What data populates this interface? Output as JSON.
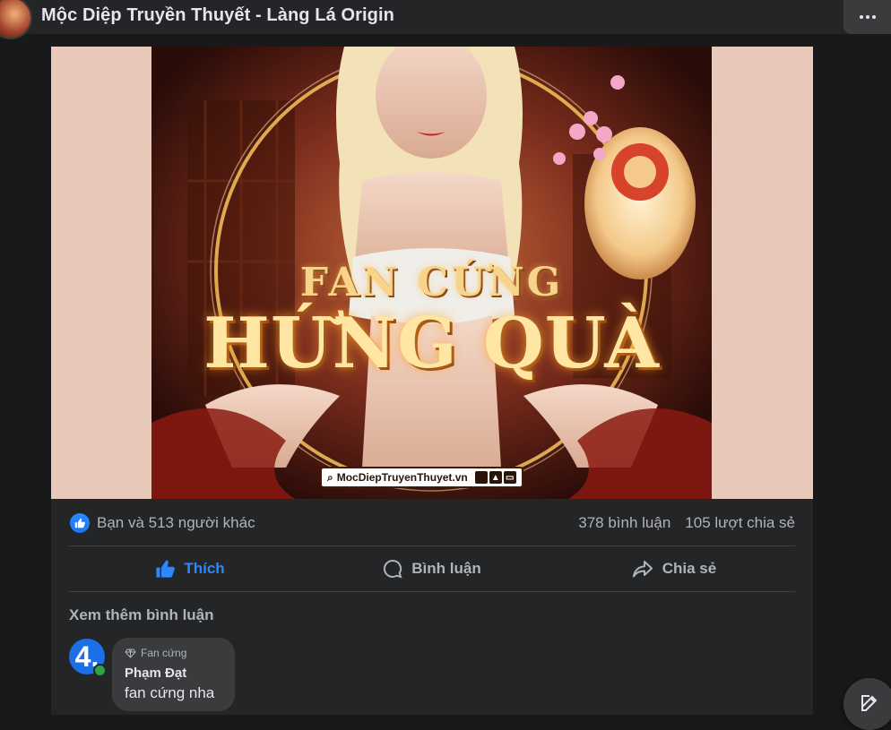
{
  "header": {
    "page_name": "Mộc Diệp Truyền Thuyết - Làng Lá Origin"
  },
  "poster": {
    "line1": "FAN CỨNG",
    "line2": "HỨNG QUÀ",
    "site": "MocDiepTruyenThuyet.vn",
    "platform_icons": [
      "apple-icon",
      "android-icon",
      "desktop-icon"
    ]
  },
  "stats": {
    "reactors": "Bạn và 513 người khác",
    "comments": "378 bình luận",
    "shares": "105 lượt chia sẻ"
  },
  "actions": {
    "like": "Thích",
    "comment": "Bình luận",
    "share": "Chia sẻ"
  },
  "comments_section": {
    "view_more": "Xem thêm bình luận",
    "comment": {
      "avatar_text": "4.",
      "badge": "Fan cứng",
      "author": "Phạm Đạt",
      "text": "fan cứng nha"
    }
  },
  "colors": {
    "background": "#18191a",
    "card": "#242526",
    "accent": "#2d88ff",
    "secondary_text": "#b0b3b8"
  }
}
